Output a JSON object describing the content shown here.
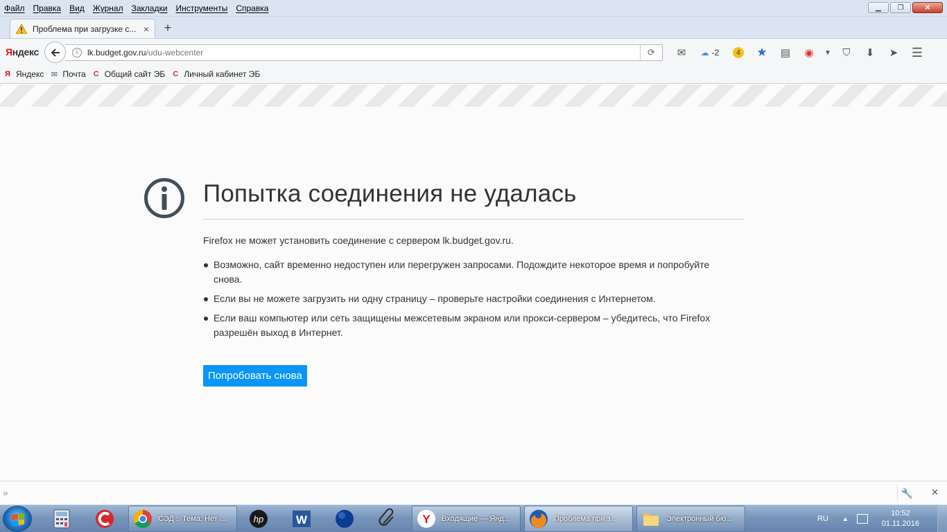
{
  "menu": [
    "Файл",
    "Правка",
    "Вид",
    "Журнал",
    "Закладки",
    "Инструменты",
    "Справка"
  ],
  "tab": {
    "title": "Проблема при загрузке с...",
    "close": "×",
    "new_tab": "+"
  },
  "nav": {
    "logo_first": "Я",
    "logo_rest": "ндекс",
    "url_host": "lk.budget.gov.ru",
    "url_path": "/udu-webcenter",
    "weather": "-2",
    "badge": "4"
  },
  "bookmarks": [
    "Яндекс",
    "Почта",
    "Общий сайт ЭБ",
    "Личный кабинет ЭБ"
  ],
  "error": {
    "title": "Попытка соединения не удалась",
    "description": "Firefox не может установить соединение с сервером lk.budget.gov.ru.",
    "items": [
      "Возможно, сайт временно недоступен или перегружен запросами. Подождите некоторое время и попробуйте снова.",
      "Если вы не можете загрузить ни одну страницу – проверьте настройки соединения с Интернетом.",
      "Если ваш компьютер или сеть защищены межсетевым экраном или прокси-сервером – убедитесь, что Firefox разрешён выход в Интернет."
    ],
    "retry_button": "Попробовать снова"
  },
  "taskbar": {
    "tasks": [
      {
        "label": "СЭД :: Тема: Нет ..."
      },
      {
        "label": "Входящие — Янд..."
      },
      {
        "label": "Проблема при з..."
      },
      {
        "label": "Электронный бю..."
      }
    ],
    "lang": "RU",
    "time": "10:52",
    "date": "01.11.2016"
  },
  "colors": {
    "accent": "#0996f8",
    "menubar": "#dbe5f1",
    "text": "#333333"
  }
}
